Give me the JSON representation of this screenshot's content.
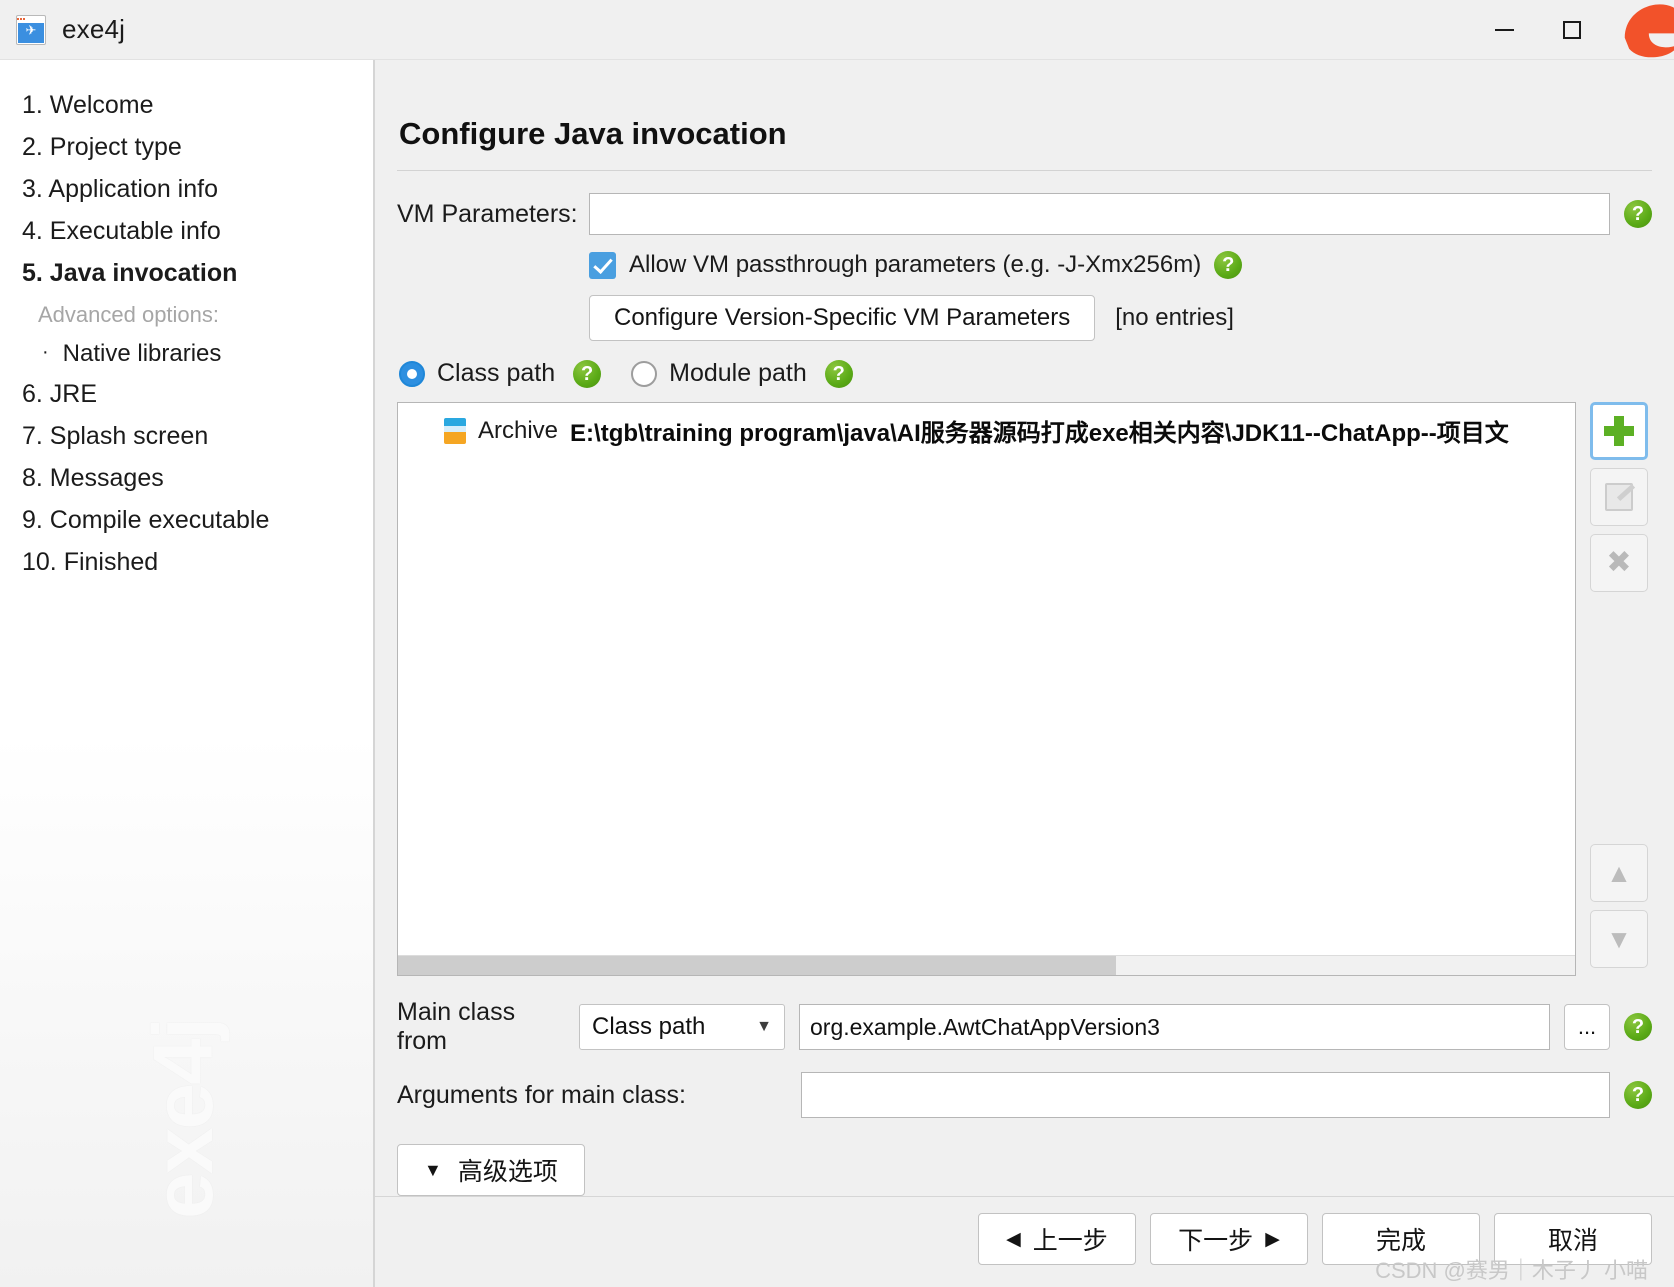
{
  "window": {
    "title": "exe4j",
    "icon": "rocket-icon",
    "minimize_label": "—",
    "maximize_label": "□",
    "close_label": "✕"
  },
  "sidebar": {
    "items": [
      {
        "label": "1. Welcome",
        "current": false
      },
      {
        "label": "2. Project type",
        "current": false
      },
      {
        "label": "3. Application info",
        "current": false
      },
      {
        "label": "4. Executable info",
        "current": false
      },
      {
        "label": "5. Java invocation",
        "current": true
      }
    ],
    "advanced_heading": "Advanced options:",
    "advanced_items": [
      {
        "bullet": "·",
        "label": "Native libraries"
      }
    ],
    "items_after": [
      {
        "label": "6. JRE"
      },
      {
        "label": "7. Splash screen"
      },
      {
        "label": "8. Messages"
      },
      {
        "label": "9. Compile executable"
      },
      {
        "label": "10. Finished"
      }
    ],
    "watermark": "exe4j"
  },
  "main": {
    "title": "Configure Java invocation",
    "vm_parameters": {
      "label": "VM Parameters:",
      "value": "",
      "placeholder": "",
      "help": "?"
    },
    "passthrough": {
      "label": "Allow VM passthrough parameters (e.g. -J-Xmx256m)",
      "checked": true,
      "help": "?"
    },
    "version_specific": {
      "button_label": "Configure Version-Specific VM Parameters",
      "status": "[no entries]"
    },
    "path_mode": {
      "class_path_label": "Class path",
      "module_path_label": "Module path",
      "selected": "class_path",
      "class_path_help": "?",
      "module_path_help": "?"
    },
    "classpath_list": {
      "entries": [
        {
          "icon": "jar-archive-icon",
          "type_label": "Archive",
          "path": "E:\\tgb\\training program\\java\\AI服务器源码打成exe相关内容\\JDK11--ChatApp--项目文"
        }
      ],
      "tools": [
        {
          "name": "add-button",
          "icon": "plus-icon",
          "enabled": true,
          "focused": true
        },
        {
          "name": "edit-button",
          "icon": "edit-icon",
          "enabled": false,
          "focused": false
        },
        {
          "name": "remove-button",
          "icon": "close-x-icon",
          "enabled": false,
          "focused": false
        }
      ],
      "move_tools": [
        {
          "name": "move-up-button",
          "icon": "chevron-up-icon",
          "glyph": "ⱏ",
          "enabled": false
        },
        {
          "name": "move-down-button",
          "icon": "chevron-down-icon",
          "glyph": "ⱟ",
          "enabled": false
        }
      ]
    },
    "main_class": {
      "label": "Main class from",
      "source_value": "Class path",
      "source_options": [
        "Class path",
        "Module path"
      ],
      "value": "org.example.AwtChatAppVersion3",
      "browse_label": "...",
      "help": "?"
    },
    "arguments": {
      "label": "Arguments for main class:",
      "value": "",
      "placeholder": "",
      "help": "?"
    },
    "advanced_options_button": {
      "caret": "▼",
      "label": "高级选项"
    }
  },
  "footer": {
    "buttons": [
      {
        "name": "back-button",
        "left_arrow": "◀",
        "label": "上一步",
        "right_arrow": ""
      },
      {
        "name": "next-button",
        "left_arrow": "",
        "label": "下一步",
        "right_arrow": "▶"
      },
      {
        "name": "finish-button",
        "left_arrow": "",
        "label": "完成",
        "right_arrow": ""
      },
      {
        "name": "cancel-button",
        "left_arrow": "",
        "label": "取消",
        "right_arrow": ""
      }
    ],
    "watermark": "CSDN @赛男｜木子丿 小喵"
  },
  "colors": {
    "accent_blue": "#2d8fe0",
    "help_green": "#5aaa16",
    "plus_green": "#5cb024",
    "edge_orange": "#f2522a"
  }
}
